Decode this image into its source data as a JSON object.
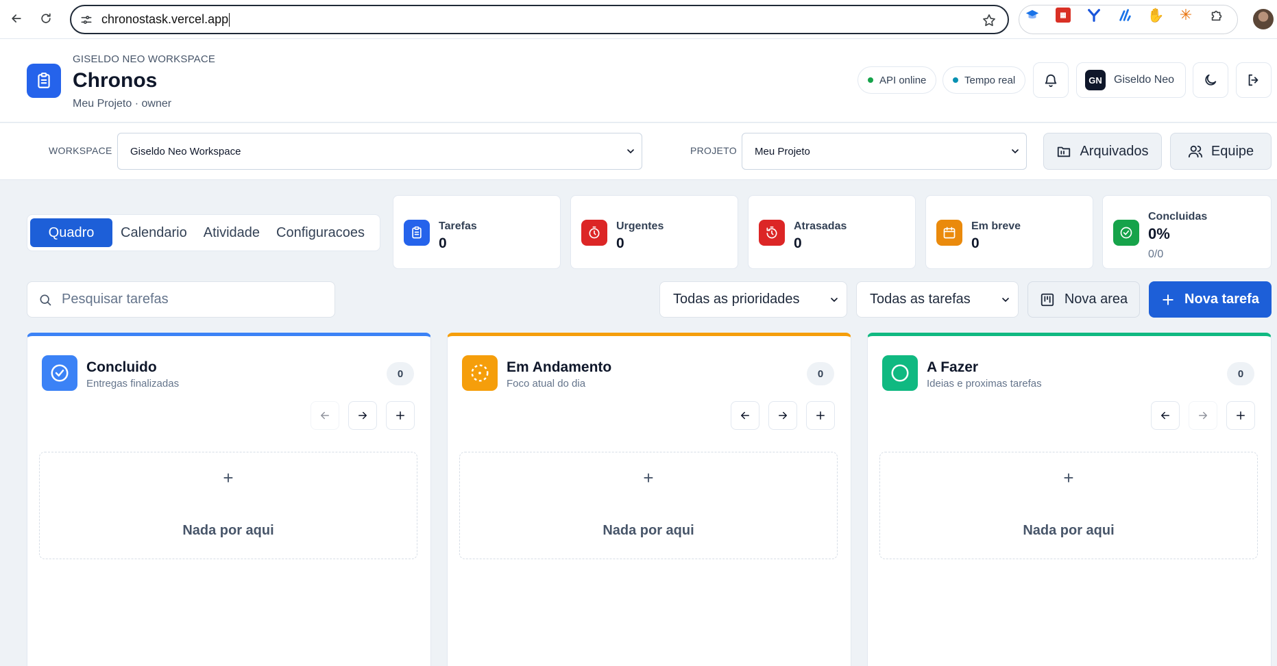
{
  "browser": {
    "url": "chronostask.vercel.app"
  },
  "header": {
    "workspace_label": "GISELDO NEO WORKSPACE",
    "app_title": "Chronos",
    "subtitle": "Meu Projeto · owner",
    "api_status": "API online",
    "realtime_status": "Tempo real",
    "user_initials": "GN",
    "user_name": "Giseldo Neo",
    "colors": {
      "accent": "#2563eb",
      "online": "#16a34a",
      "realtime": "#0891b2"
    }
  },
  "selectors": {
    "workspace_label": "WORKSPACE",
    "workspace_value": "Giseldo Neo Workspace",
    "project_label": "PROJETO",
    "project_value": "Meu Projeto",
    "archived_label": "Arquivados",
    "team_label": "Equipe"
  },
  "tabs": [
    {
      "label": "Quadro",
      "active": true
    },
    {
      "label": "Calendario",
      "active": false
    },
    {
      "label": "Atividade",
      "active": false
    },
    {
      "label": "Configuracoes",
      "active": false
    }
  ],
  "stats": [
    {
      "label": "Tarefas",
      "value": "0",
      "icon": "clipboard-icon",
      "color": "#2563eb"
    },
    {
      "label": "Urgentes",
      "value": "0",
      "icon": "timer-icon",
      "color": "#dc2626"
    },
    {
      "label": "Atrasadas",
      "value": "0",
      "icon": "timer-reset-icon",
      "color": "#dc2626"
    },
    {
      "label": "Em breve",
      "value": "0",
      "icon": "calendar-icon",
      "color": "#ea8a0c"
    },
    {
      "label": "Concluidas",
      "value": "0%",
      "sub": "0/0",
      "icon": "check-circle-icon",
      "color": "#16a34a"
    }
  ],
  "filters": {
    "search_placeholder": "Pesquisar tarefas",
    "priority_value": "Todas as prioridades",
    "tasks_value": "Todas as tarefas",
    "new_area_label": "Nova area",
    "new_task_label": "Nova tarefa"
  },
  "columns": [
    {
      "title": "Concluido",
      "subtitle": "Entregas finalizadas",
      "count": "0",
      "empty_text": "Nada por aqui",
      "plus": "+",
      "color": "#3b82f6"
    },
    {
      "title": "Em Andamento",
      "subtitle": "Foco atual do dia",
      "count": "0",
      "empty_text": "Nada por aqui",
      "plus": "+",
      "color": "#f59e0b"
    },
    {
      "title": "A Fazer",
      "subtitle": "Ideias e proximas tarefas",
      "count": "0",
      "empty_text": "Nada por aqui",
      "plus": "+",
      "color": "#10b981"
    }
  ]
}
